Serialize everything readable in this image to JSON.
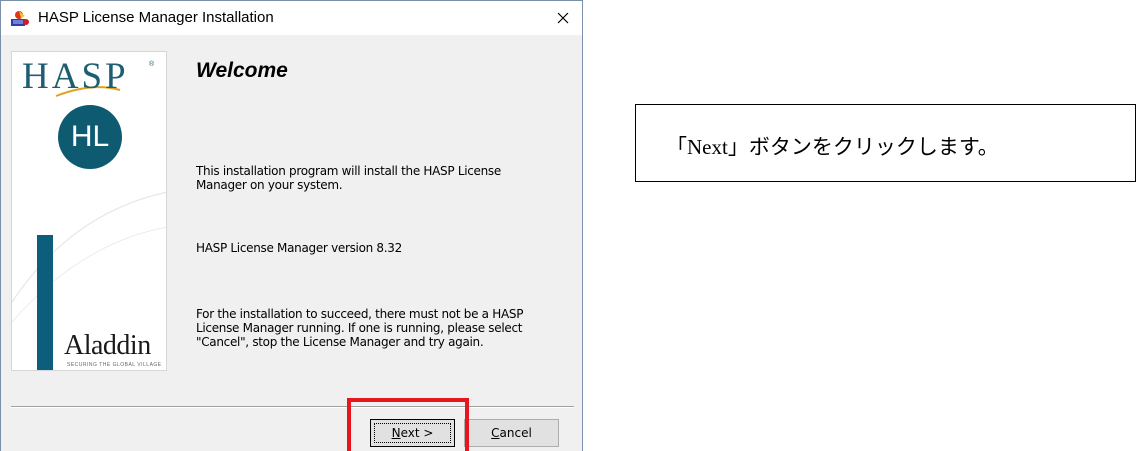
{
  "window": {
    "title": "HASP License Manager Installation",
    "icon": "installer-icon"
  },
  "side_panel": {
    "brand": "HASP",
    "brand_mark": "®",
    "product_badge": "HL",
    "company": "Aladdin",
    "company_tagline": "SECURING THE GLOBAL VILLAGE",
    "accent_color": "#0d5e7c"
  },
  "content": {
    "heading": "Welcome",
    "paragraph_1": "This installation program will install the HASP License Manager on your system.",
    "paragraph_2": "HASP License Manager version 8.32",
    "paragraph_3": "For the installation to succeed, there must not be a HASP License Manager running. If one is running, please select \"Cancel\", stop the License Manager and try again."
  },
  "buttons": {
    "next_mnemonic": "N",
    "next_rest": "ext >",
    "cancel_mnemonic": "C",
    "cancel_rest": "ancel"
  },
  "annotation": {
    "callout_text": "「Next」ボタンをクリックします。",
    "highlight_color": "#e8141e"
  }
}
